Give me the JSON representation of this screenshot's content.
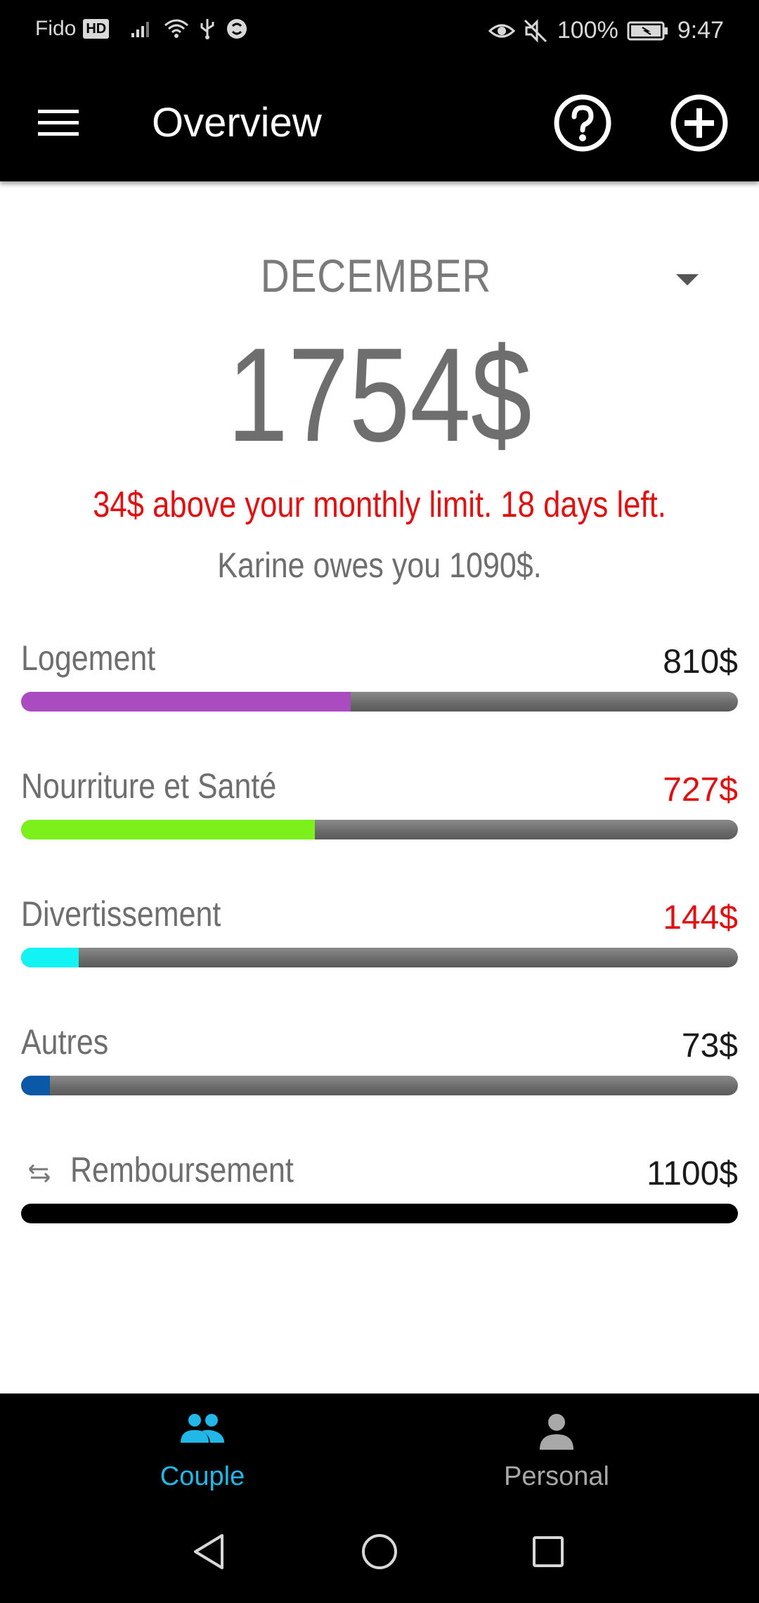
{
  "status_bar": {
    "carrier": "Fido",
    "hd_badge": "HD",
    "battery": "100%",
    "time": "9:47",
    "icons_left": [
      "signal-icon",
      "wifi-icon",
      "usb-icon",
      "sync-icon"
    ],
    "icons_right": [
      "eye-icon",
      "mute-icon",
      "battery-icon"
    ]
  },
  "app_bar": {
    "title": "Overview",
    "menu_icon": "menu-icon",
    "help_icon": "help-circle-icon",
    "add_icon": "add-circle-icon"
  },
  "summary": {
    "month": "DECEMBER",
    "total": "1754$",
    "warning": "34$ above your monthly limit. 18 days left.",
    "owes": "Karine owes you 1090$."
  },
  "categories": [
    {
      "label": "Logement",
      "amount": "810$",
      "over": false,
      "fill_fraction": 0.46,
      "color": "#aa4bc0"
    },
    {
      "label": "Nourriture et Santé",
      "amount": "727$",
      "over": true,
      "fill_fraction": 0.41,
      "color": "#7cf01a"
    },
    {
      "label": "Divertissement",
      "amount": "144$",
      "over": true,
      "fill_fraction": 0.08,
      "color": "#12f4f4"
    },
    {
      "label": "Autres",
      "amount": "73$",
      "over": false,
      "fill_fraction": 0.04,
      "color": "#0a58a8"
    }
  ],
  "reimbursement": {
    "label": "Remboursement",
    "amount": "1100$",
    "icon": "swap-arrows-icon",
    "color": "#000000"
  },
  "bottom_nav": {
    "tabs": [
      {
        "label": "Couple",
        "icon": "people-icon",
        "active": true
      },
      {
        "label": "Personal",
        "icon": "person-icon",
        "active": false
      }
    ],
    "active_color": "#21b8e8",
    "inactive_color": "#a8a8a8"
  },
  "system_nav": {
    "buttons": [
      "back-icon",
      "home-icon",
      "recents-icon"
    ]
  }
}
